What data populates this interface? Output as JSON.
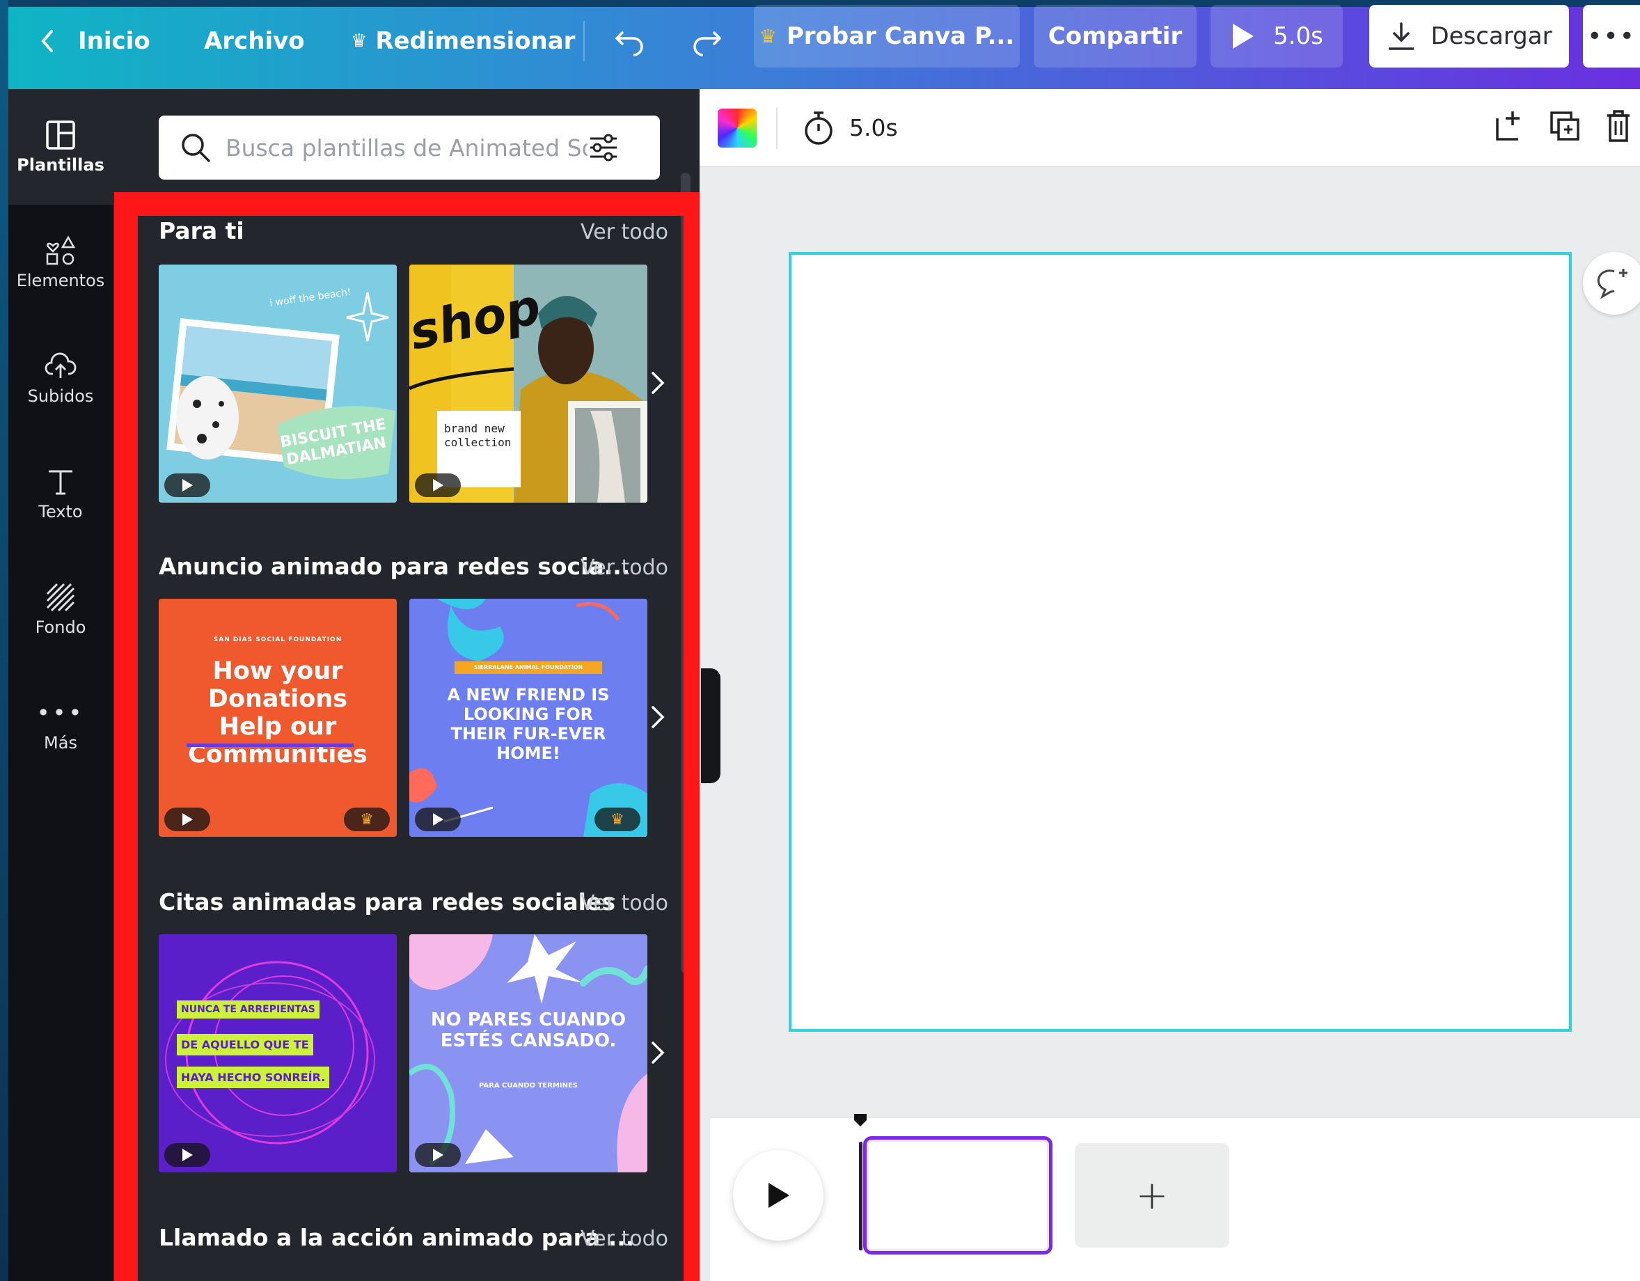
{
  "topbar": {
    "home_label": "Inicio",
    "file_label": "Archivo",
    "resize_label": "Redimensionar",
    "try_pro_label": "Probar Canva P...",
    "share_label": "Compartir",
    "play_duration": "5.0s",
    "download_label": "Descargar"
  },
  "sidebar": {
    "items": [
      {
        "label": "Plantillas",
        "icon": "templates-icon"
      },
      {
        "label": "Elementos",
        "icon": "elements-icon"
      },
      {
        "label": "Subidos",
        "icon": "upload-cloud-icon"
      },
      {
        "label": "Texto",
        "icon": "text-icon"
      },
      {
        "label": "Fondo",
        "icon": "background-icon"
      },
      {
        "label": "Más",
        "icon": "more-icon"
      }
    ]
  },
  "search": {
    "placeholder": "Busca plantillas de Animated Socia"
  },
  "sections": [
    {
      "title": "Para ti",
      "link": "Ver todo",
      "thumbs": [
        {
          "text": "BISCUIT THE DALMATIAN",
          "small": "i woff the beach!",
          "premium": false
        },
        {
          "text": "shop",
          "small": "brand new collection",
          "premium": false
        }
      ]
    },
    {
      "title": "Anuncio animado para redes socia...",
      "link": "Ver todo",
      "thumbs": [
        {
          "text": "How your Donations Help our Communities",
          "small": "SAN DIAS SOCIAL FOUNDATION",
          "premium": true
        },
        {
          "text": "A NEW FRIEND IS LOOKING FOR THEIR FUR-EVER HOME!",
          "small": "SIERRALANE ANIMAL FOUNDATION",
          "premium": true
        }
      ]
    },
    {
      "title": "Citas animadas para redes sociales",
      "link": "Ver todo",
      "thumbs": [
        {
          "line1": "NUNCA TE ARREPIENTAS",
          "line2": "DE AQUELLO QUE TE",
          "line3": "HAYA HECHO SONREÍR.",
          "premium": false
        },
        {
          "text": "NO PARES CUANDO ESTÉS CANSADO.",
          "small": "PARA CUANDO TERMINES",
          "premium": false
        }
      ]
    },
    {
      "title": "Llamado a la acción animado para ...",
      "link": "Ver todo"
    }
  ],
  "editor_toolbar": {
    "duration": "5.0s"
  },
  "timeline": {
    "add_page": "+"
  },
  "colors": {
    "accent_purple": "#7d2ae8",
    "canvas_border": "#2ed3e0",
    "highlight_red": "#ff1616",
    "panel_bg": "#23262d"
  }
}
